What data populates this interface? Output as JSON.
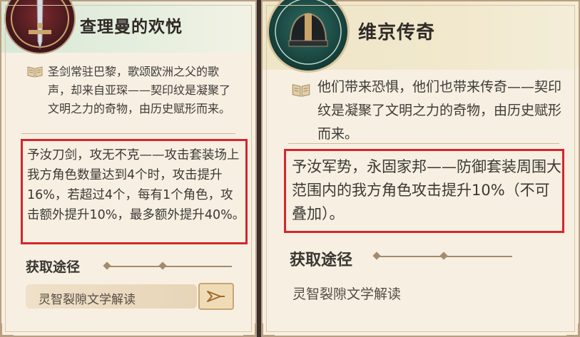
{
  "cards": [
    {
      "title": "查理曼的欢悦",
      "lore": "圣剑常驻巴黎，歌颂欧洲之父的歌声，却来自亚琛——契印纹是凝聚了文明之力的奇物，由历史赋形而来。",
      "effect": "予汝刀剑，攻无不克——攻击套装场上我方角色数量达到4个时，攻击提升16%，若超过4个，每有1个角色，攻击额外提升10%，最多额外提升40%。",
      "acquire_title": "获取途径",
      "source": "灵智裂隙文学解读",
      "emblem_icon": "sword-emblem-icon",
      "accent": "#d6252c"
    },
    {
      "title": "维京传奇",
      "lore": "他们带来恐惧，他们也带来传奇——契印纹是凝聚了文明之力的奇物，由历史赋形而来。",
      "effect": "予汝军势，永固家邦——防御套装周围大范围内的我方角色攻击提升10%（不可叠加）。",
      "acquire_title": "获取途径",
      "source": "灵智裂隙文学解读",
      "emblem_icon": "viking-helmet-emblem-icon",
      "accent": "#d6252c"
    }
  ]
}
